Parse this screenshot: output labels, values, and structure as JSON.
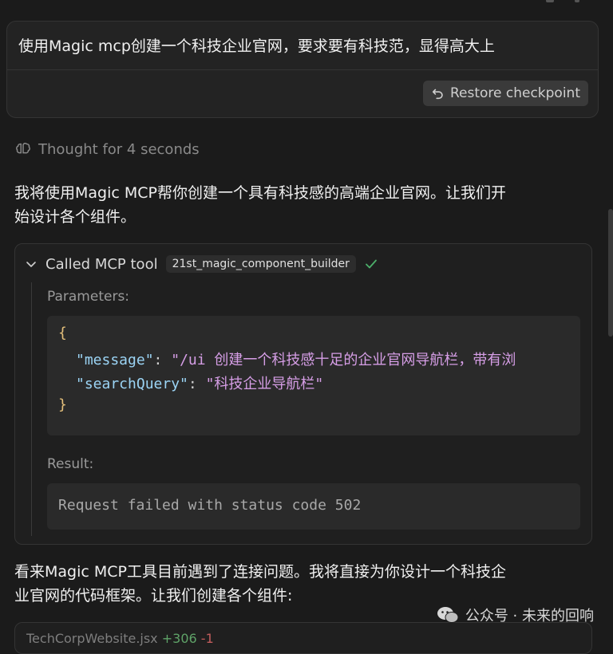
{
  "user_message": {
    "text": "使用Magic mcp创建一个科技企业官网，要求要有科技范，显得高大上",
    "restore_label": "Restore checkpoint"
  },
  "thought": {
    "label": "Thought for 4 seconds"
  },
  "paragraph1": {
    "line1": "我将使用Magic MCP帮你创建一个具有科技感的高端企业官网。让我们开",
    "line2": "始设计各个组件。"
  },
  "tool_call": {
    "header": "Called MCP tool",
    "tool_name": "21st_magic_component_builder",
    "parameters_label": "Parameters:",
    "params": {
      "open_brace": "{",
      "close_brace": "}",
      "message_key": "\"message\"",
      "message_value": "\"/ui 创建一个科技感十足的企业官网导航栏，带有浏",
      "search_key": "\"searchQuery\"",
      "search_value": "\"科技企业导航栏\""
    },
    "result_label": "Result:",
    "result_text": "Request failed with status code 502"
  },
  "paragraph2": {
    "line1": "看来Magic MCP工具目前遇到了连接问题。我将直接为你设计一个科技企",
    "line2": "业官网的代码框架。让我们创建各个组件:"
  },
  "bottom_card": {
    "file_name": "TechCorpWebsite.jsx",
    "added": "+306",
    "removed": "-1"
  },
  "watermark": {
    "text": "公众号 · 未来的回响"
  },
  "colors": {
    "background": "#1b1b1b",
    "card": "#232323",
    "check_green": "#4caf6a",
    "json_key": "#9bd4f5",
    "json_string": "#d69ee6",
    "json_brace": "#e5c07b"
  }
}
